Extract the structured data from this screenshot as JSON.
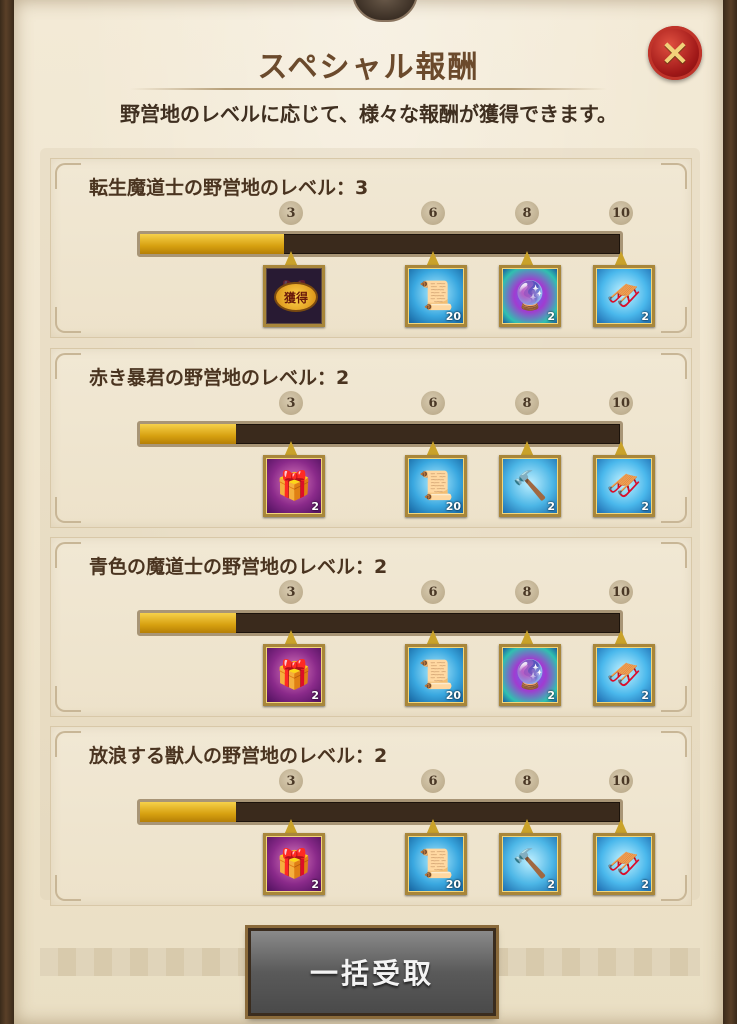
{
  "header": {
    "title": "スペシャル報酬",
    "subtitle": "野営地のレベルに応じて、様々な報酬が獲得できます。",
    "close_label": "×"
  },
  "milestones": [
    "3",
    "6",
    "8",
    "10"
  ],
  "sections": [
    {
      "label": "転生魔道士の野営地のレベル：3",
      "progress": 0.3,
      "rewards": [
        {
          "icon": "treasure-chest-icon",
          "style": "r-claimed",
          "claimed": true,
          "badge": "獲得",
          "count": ""
        },
        {
          "icon": "scroll-icon",
          "style": "r-scroll",
          "count": "20"
        },
        {
          "icon": "orb-icon",
          "style": "r-orb",
          "count": "2"
        },
        {
          "icon": "sled-icon",
          "style": "r-sled",
          "count": "2"
        }
      ]
    },
    {
      "label": "赤き暴君の野営地のレベル：2",
      "progress": 0.2,
      "rewards": [
        {
          "icon": "treasure-chest-icon",
          "style": "r-chest",
          "count": "2"
        },
        {
          "icon": "scroll-icon",
          "style": "r-scroll",
          "count": "20"
        },
        {
          "icon": "hammer-icon",
          "style": "r-hammer",
          "count": "2"
        },
        {
          "icon": "sled-icon",
          "style": "r-sled",
          "count": "2"
        }
      ]
    },
    {
      "label": "青色の魔道士の野営地のレベル：2",
      "progress": 0.2,
      "rewards": [
        {
          "icon": "treasure-chest-icon",
          "style": "r-chest",
          "count": "2"
        },
        {
          "icon": "scroll-icon",
          "style": "r-scroll",
          "count": "20"
        },
        {
          "icon": "orb-icon",
          "style": "r-orb",
          "count": "2"
        },
        {
          "icon": "sled-icon",
          "style": "r-sled",
          "count": "2"
        }
      ]
    },
    {
      "label": "放浪する獣人の野営地のレベル：2",
      "progress": 0.2,
      "rewards": [
        {
          "icon": "treasure-chest-icon",
          "style": "r-chest",
          "count": "2"
        },
        {
          "icon": "scroll-icon",
          "style": "r-scroll",
          "count": "20"
        },
        {
          "icon": "hammer-icon",
          "style": "r-hammer",
          "count": "2"
        },
        {
          "icon": "sled-icon",
          "style": "r-sled",
          "count": "2"
        }
      ]
    }
  ],
  "footer": {
    "claim_all_label": "一括受取"
  },
  "colors": {
    "parchment": "#efe4cc",
    "progress_gold": "#d6a010",
    "close_red": "#a01818"
  }
}
